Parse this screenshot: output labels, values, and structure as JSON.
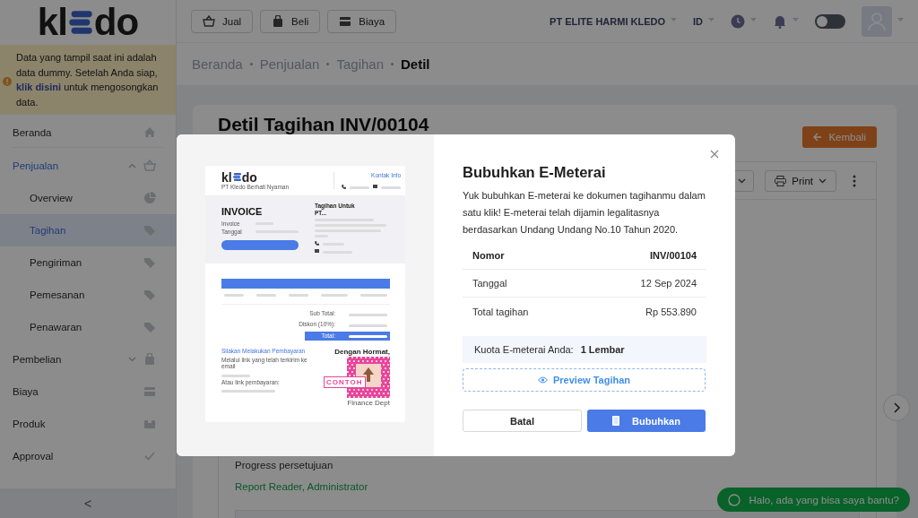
{
  "logo": {
    "left": "kl",
    "right": "do"
  },
  "notice": {
    "before": "Data yang tampil saat ini adalah data dummy. Setelah Anda siap,",
    "link": "klik disini",
    "after": "untuk mengosongkan data."
  },
  "sidebar": {
    "items": [
      {
        "label": "Beranda",
        "selected": false
      },
      {
        "label": "Penjualan",
        "selected": false,
        "expanded": true,
        "children": [
          {
            "label": "Overview",
            "selected": false
          },
          {
            "label": "Tagihan",
            "selected": true
          },
          {
            "label": "Pengiriman",
            "selected": false
          },
          {
            "label": "Pemesanan",
            "selected": false
          },
          {
            "label": "Penawaran",
            "selected": false
          }
        ]
      },
      {
        "label": "Pembelian",
        "selected": false,
        "expanded": false
      },
      {
        "label": "Biaya",
        "selected": false
      },
      {
        "label": "Produk",
        "selected": false
      },
      {
        "label": "Approval",
        "selected": false
      }
    ],
    "collapse": "<"
  },
  "header": {
    "quick_buttons": [
      "Jual",
      "Beli",
      "Biaya"
    ],
    "company": "PT ELITE HARMI KLEDO",
    "language": "ID",
    "dark_mode": {
      "on": false
    }
  },
  "breadcrumb": [
    "Beranda",
    "Penjualan",
    "Tagihan",
    "Detil"
  ],
  "page": {
    "title": "Detil Tagihan INV/00104",
    "back_button": "Kembali",
    "print_button": "Print",
    "approval_label": "Progress persetujuan",
    "approval_value": "Report Reader, Administrator"
  },
  "chat_button": "Halo, ada yang bisa saya bantu?",
  "modal": {
    "preview": {
      "logo": {
        "left": "kl",
        "right": "do"
      },
      "tagline": "PT Kledo Berhati Nyaman",
      "contact_heading": "Kontak Info",
      "heading": "INVOICE",
      "fields": [
        "Invoice",
        "Tanggal"
      ],
      "bill_to": "Tagihan Untuk",
      "bill_to_name": "PT...",
      "summary": [
        {
          "label": "Sub Total:",
          "highlighted": false
        },
        {
          "label": "Diskon (10%):",
          "highlighted": false
        },
        {
          "label": "Total:",
          "highlighted": true
        }
      ],
      "payment_heading": "Silakan Melakukan Pembayaran",
      "payment_notes": [
        "Melalui link yang telah terkirim ke email",
        "Atau link pembayaran:"
      ],
      "closing": "Dengan Hormat,",
      "stamp_label": "CONTOH",
      "signatory": "Finance Dept"
    },
    "title": "Bubuhkan E-Meterai",
    "description": "Yuk bubuhkan E-meterai ke dokumen tagihanmu dalam satu klik! E-meterai telah dijamin legalitasnya berdasarkan Undang Undang No.10 Tahun 2020.",
    "details": [
      {
        "label": "Nomor",
        "value": "INV/00104",
        "emphasized": true
      },
      {
        "label": "Tanggal",
        "value": "12 Sep 2024",
        "emphasized": false
      },
      {
        "label": "Total tagihan",
        "value": "Rp 553.890",
        "emphasized": false
      }
    ],
    "quota_label": "Kuota E-meterai Anda:",
    "quota_value": "1 Lembar",
    "preview_button": "Preview Tagihan",
    "cancel_button": "Batal",
    "confirm_button": "Bubuhkan"
  }
}
